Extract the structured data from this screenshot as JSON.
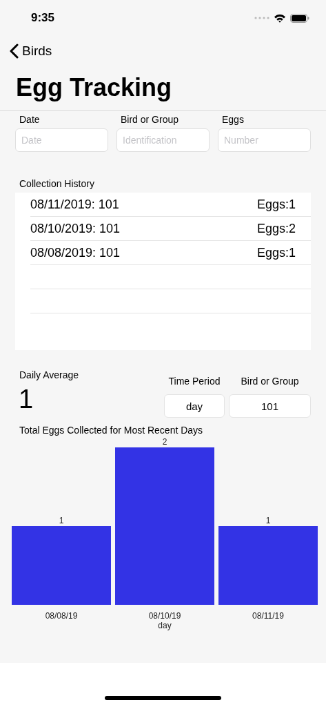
{
  "status_bar": {
    "time": "9:35"
  },
  "nav": {
    "back_label": "Birds",
    "title": "Egg Tracking"
  },
  "entry_fields": [
    {
      "label": "Date",
      "placeholder": "Date"
    },
    {
      "label": "Bird or Group",
      "placeholder": "Identification"
    },
    {
      "label": "Eggs",
      "placeholder": "Number"
    }
  ],
  "collection_history": {
    "title": "Collection History",
    "rows": [
      {
        "entry": "08/11/2019: 101",
        "eggs": "Eggs:1"
      },
      {
        "entry": "08/10/2019: 101",
        "eggs": "Eggs:2"
      },
      {
        "entry": "08/08/2019: 101",
        "eggs": "Eggs:1"
      }
    ]
  },
  "daily_average": {
    "label": "Daily Average",
    "value": "1"
  },
  "filters": [
    {
      "label": "Time Period",
      "value": "day"
    },
    {
      "label": "Bird or Group",
      "value": "101"
    }
  ],
  "chart": {
    "title": "Total Eggs Collected for Most Recent Days",
    "chart_data": {
      "type": "bar",
      "xlabel": "day",
      "categories": [
        "08/08/19",
        "08/10/19",
        "08/11/19"
      ],
      "series": [
        {
          "color": "#3333e5",
          "values": [
            1,
            2,
            1
          ]
        }
      ],
      "data_labels": true
    }
  }
}
